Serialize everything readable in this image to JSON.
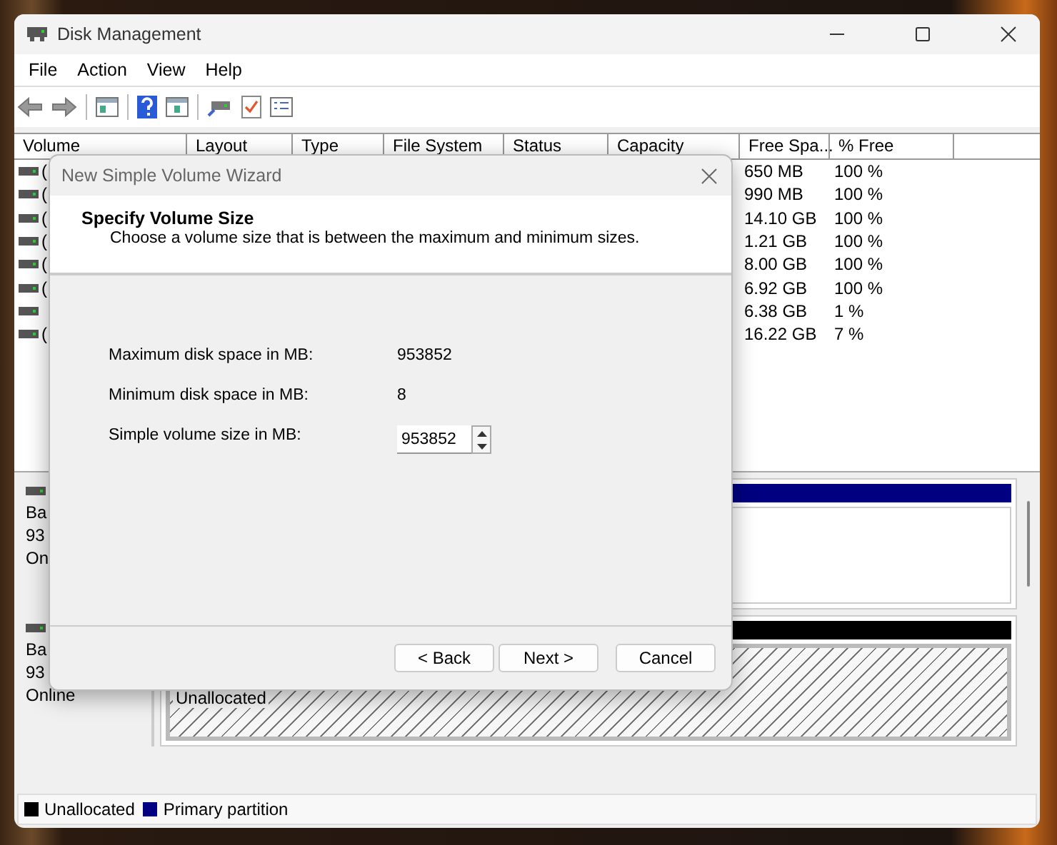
{
  "window": {
    "title": "Disk Management"
  },
  "menu": [
    "File",
    "Action",
    "View",
    "Help"
  ],
  "volume_list": {
    "columns": [
      "Volume",
      "Layout",
      "Type",
      "File System",
      "Status",
      "Capacity",
      "Free Spa...",
      "% Free"
    ],
    "rows": [
      {
        "volume": "(",
        "free_space": "650 MB",
        "percent_free": "100 %"
      },
      {
        "volume": "(",
        "free_space": "990 MB",
        "percent_free": "100 %"
      },
      {
        "volume": "(",
        "free_space": "14.10 GB",
        "percent_free": "100 %"
      },
      {
        "volume": "(",
        "free_space": "1.21 GB",
        "percent_free": "100 %"
      },
      {
        "volume": "(",
        "free_space": "8.00 GB",
        "percent_free": "100 %"
      },
      {
        "volume": "(",
        "free_space": "6.92 GB",
        "percent_free": "100 %"
      },
      {
        "free_space": "6.38 GB",
        "percent_free": "1 %"
      },
      {
        "volume": "(",
        "free_space": "16.22 GB",
        "percent_free": "7 %"
      }
    ]
  },
  "disks": [
    {
      "labels": [
        "Ba",
        "93",
        "On"
      ],
      "partition": {
        "kind": "primary"
      }
    },
    {
      "labels": [
        "Ba",
        "93",
        "Online"
      ],
      "partition": {
        "kind": "unallocated",
        "label": "Unallocated"
      }
    }
  ],
  "legend": [
    {
      "label": "Unallocated",
      "color": "#000000"
    },
    {
      "label": "Primary partition",
      "color": "#000080"
    }
  ],
  "dialog": {
    "title": "New Simple Volume Wizard",
    "heading": "Specify Volume Size",
    "subtitle": "Choose a volume size that is between the maximum and minimum sizes.",
    "fields": [
      {
        "kind": "readout",
        "label": "Maximum disk space in MB:",
        "value": "953852"
      },
      {
        "kind": "readout",
        "label": "Minimum disk space in MB:",
        "value": "8"
      },
      {
        "kind": "spinner",
        "label": "Simple volume size in MB:",
        "value": "953852"
      }
    ],
    "buttons": [
      "< Back",
      "Next >",
      "Cancel"
    ]
  }
}
